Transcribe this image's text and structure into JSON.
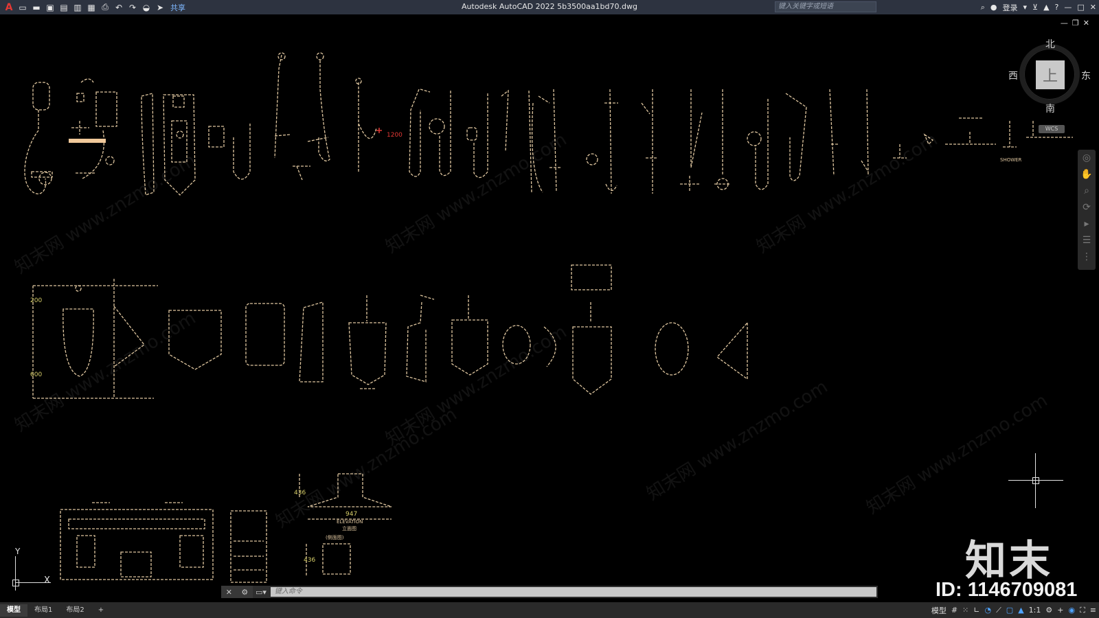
{
  "app": {
    "logo": "A",
    "title": "Autodesk AutoCAD 2022    5b3500aa1bd70.dwg",
    "share_label": "共享",
    "search_placeholder": "键入关键字或短语",
    "login_label": "登录"
  },
  "viewcube": {
    "north": "北",
    "south": "南",
    "east": "东",
    "west": "西",
    "face": "上",
    "wcs": "WCS"
  },
  "drawing": {
    "dims": [
      "200",
      "600",
      "436",
      "947",
      "436"
    ],
    "red_dim": "1200",
    "labels": {
      "shower": "SHOWER",
      "elevation": "ELEVATION",
      "elevation_cn": "立面图",
      "side_cn": "(侧面图)"
    }
  },
  "ucs": {
    "x": "X",
    "y": "Y"
  },
  "cmdline": {
    "placeholder": "键入命令"
  },
  "tabs": [
    {
      "label": "模型"
    },
    {
      "label": "布局1"
    },
    {
      "label": "布局2"
    },
    {
      "label": "+"
    }
  ],
  "status": {
    "model_label": "模型",
    "scale_label": "1:1"
  },
  "watermark": {
    "text": "知末网 www.znzmo.com",
    "brand": "知末",
    "id": "ID: 1146709081"
  },
  "colors": {
    "line": "#e0c7a0",
    "dim": "#d8cf6a",
    "accent_red": "#e53935",
    "highlight": "#f0c89a"
  }
}
